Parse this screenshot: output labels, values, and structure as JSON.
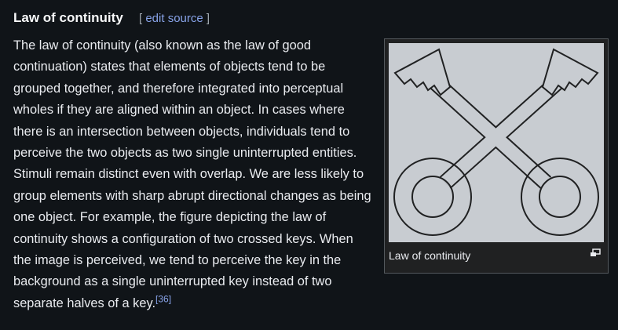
{
  "section": {
    "title": "Law of continuity",
    "edit_open": "[",
    "edit_label": "edit source",
    "edit_close": "]"
  },
  "figure": {
    "caption": "Law of continuity",
    "icon": "magnify-clip-icon"
  },
  "paragraph": {
    "text": "The law of continuity (also known as the law of good continuation) states that elements of objects tend to be grouped together, and therefore integrated into perceptual wholes if they are aligned within an object. In cases where there is an intersection between objects, individuals tend to perceive the two objects as two single uninterrupted entities. Stimuli remain distinct even with overlap. We are less likely to group elements with sharp abrupt directional changes as being one object. For example, the figure depicting the law of continuity shows a configuration of two crossed keys. When the image is perceived, we tend to perceive the key in the background as a single uninterrupted key instead of two separate halves of a key.",
    "citation": "[36]"
  },
  "colors": {
    "background": "#101418",
    "text": "#eaecf0",
    "link": "#88a3e8",
    "image_background": "#c8ccd1"
  }
}
